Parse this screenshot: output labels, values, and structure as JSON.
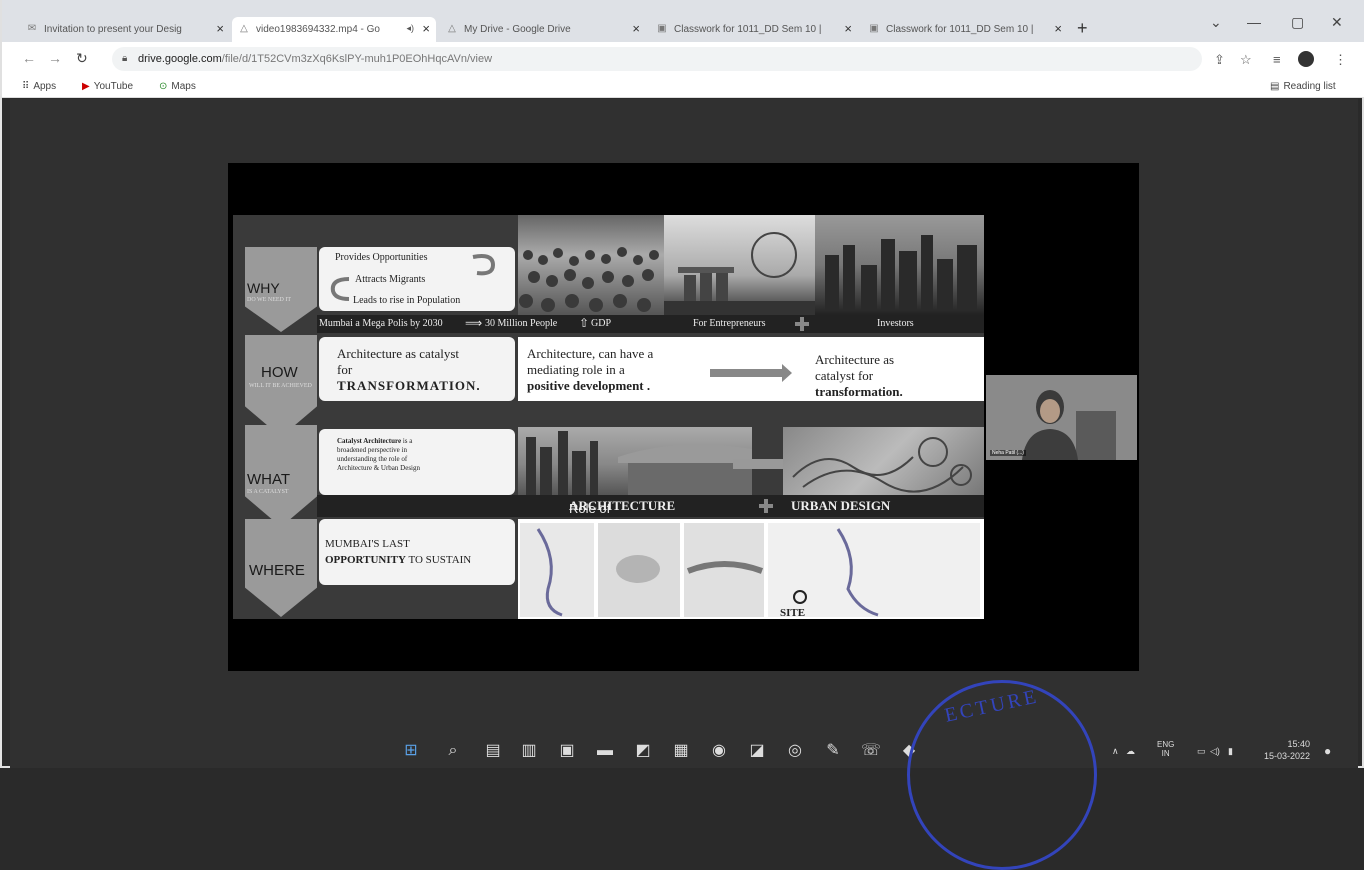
{
  "browser": {
    "tabs": [
      {
        "title": "Invitation to present your Desig",
        "icon": "gmail-icon",
        "active": false
      },
      {
        "title": "video1983694332.mp4 - Go",
        "icon": "drive-icon",
        "active": true
      },
      {
        "title": "My Drive - Google Drive",
        "icon": "drive-icon",
        "active": false
      },
      {
        "title": "Classwork for 1011_DD Sem 10 |",
        "icon": "classroom-icon",
        "active": false
      },
      {
        "title": "Classwork for 1011_DD Sem 10 |",
        "icon": "classroom-icon",
        "active": false
      }
    ],
    "new_tab": "+",
    "window_controls": {
      "minimize": "—",
      "maximize": "▢",
      "close": "✕"
    },
    "url_host": "drive.google.com",
    "url_path": "/file/d/1T52CVm3zXq6KslPY-muh1P0EOhHqcAVn/view",
    "bookmarks": [
      {
        "label": "Apps",
        "icon": "apps-grid-icon"
      },
      {
        "label": "YouTube",
        "icon": "youtube-icon"
      },
      {
        "label": "Maps",
        "icon": "maps-icon"
      }
    ],
    "reading_list": "Reading list"
  },
  "slide": {
    "why": {
      "label": "WHY",
      "sub": "DO WE NEED IT",
      "lines": [
        "Provides Opportunities",
        "Attracts Migrants",
        "Leads to rise in Population"
      ],
      "strip": [
        "Mumbai a Mega Polis by 2030",
        "30 Million People",
        "GDP",
        "For Entrepreneurs",
        "Investors"
      ]
    },
    "how": {
      "label": "HOW",
      "sub": "WILL IT BE ACHIEVED",
      "card": [
        "Architecture as catalyst",
        "for",
        "TRANSFORMATION."
      ],
      "mid": [
        "Architecture, can have a",
        "mediating role in a",
        "positive development",
        "."
      ],
      "right": [
        "Architecture as",
        "catalyst for",
        "transformation."
      ]
    },
    "what": {
      "label": "WHAT",
      "sub": "IS A CATALYST",
      "card_bold": "Catalyst Architecture",
      "card_text": [
        "is a",
        "broadened perspective in",
        "understanding the role of",
        "Architecture & Urban Design"
      ],
      "strip_pre": "Role of",
      "strip_a": "ARCHITECTURE",
      "strip_b": "URBAN DESIGN"
    },
    "where": {
      "label": "WHERE",
      "card": [
        "MUMBAI'S LAST",
        "OPPORTUNITY",
        "TO SUSTAIN"
      ],
      "site": "SITE"
    }
  },
  "camera": {
    "name": "Neha Patil (...)"
  },
  "system_tray": {
    "lang": "ENG",
    "region": "IN",
    "time": "15:40",
    "date": "15-03-2022"
  },
  "stamp_text": "ECTURE"
}
